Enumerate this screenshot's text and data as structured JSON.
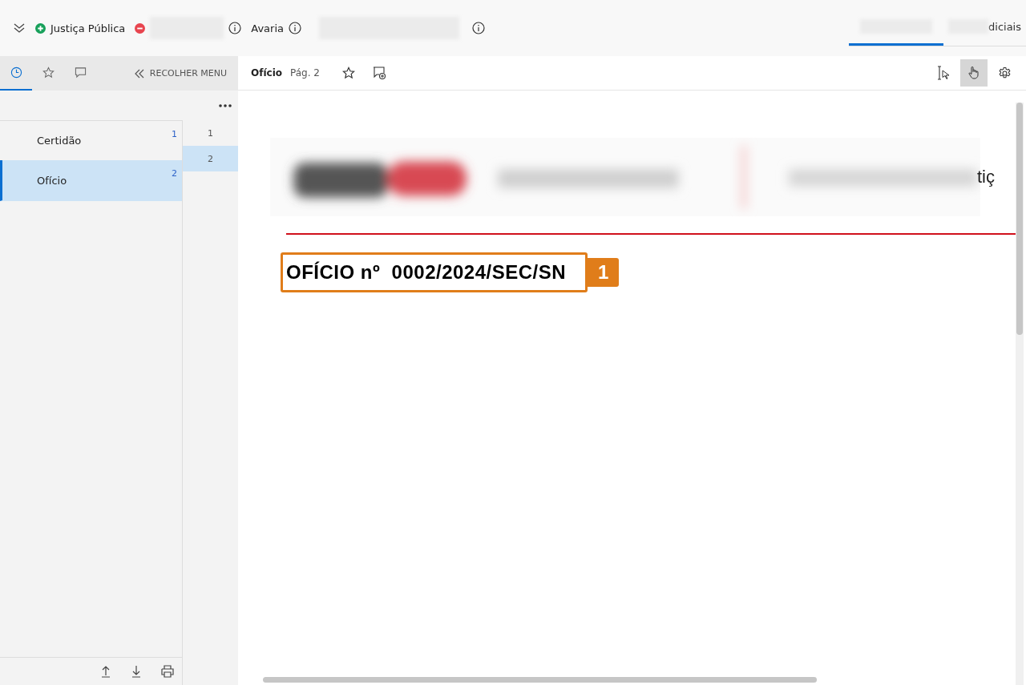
{
  "header": {
    "tags": [
      {
        "kind": "added",
        "label": "Justiça Pública"
      },
      {
        "kind": "removed"
      }
    ],
    "fields": [
      {
        "label": "Avaria"
      }
    ],
    "tabs": [
      {
        "selected": true
      },
      {
        "label": "diciais",
        "selected": false
      }
    ]
  },
  "sidebar": {
    "tabs": [
      {
        "kind": "history",
        "selected": true
      },
      {
        "kind": "favorites",
        "selected": false
      },
      {
        "kind": "comments",
        "selected": false
      }
    ],
    "collapse_button": "RECOLHER MENU",
    "documents": [
      {
        "title": "Certidão",
        "page": "1",
        "selected": false
      },
      {
        "title": "Ofício",
        "page": "2",
        "selected": true
      }
    ],
    "pages": [
      {
        "number": "1",
        "selected": false
      },
      {
        "number": "2",
        "selected": true
      }
    ]
  },
  "viewer": {
    "title": "Ofício",
    "page": "Pág. 2",
    "tools": [
      {
        "kind": "text-select",
        "selected": false
      },
      {
        "kind": "hand",
        "selected": true
      },
      {
        "kind": "settings",
        "selected": false
      }
    ],
    "document": {
      "letterhead_fragment": "tiç",
      "heading": "OFÍCIO nº  0002/2024/SEC/SN",
      "callout": "1"
    }
  }
}
